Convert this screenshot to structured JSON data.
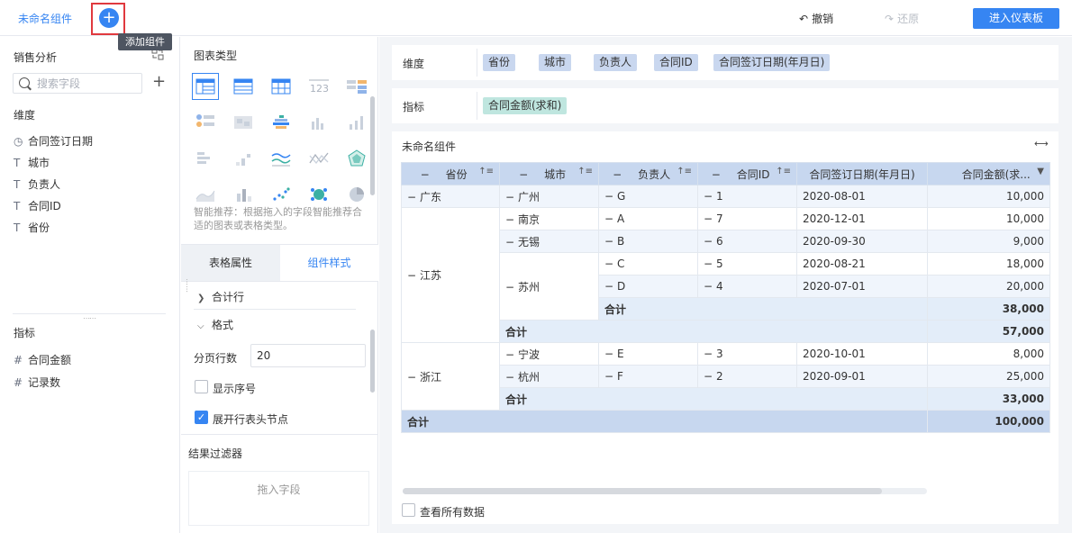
{
  "topbar": {
    "component_name": "未命名组件",
    "add_tooltip": "添加组件",
    "undo": "撤销",
    "redo": "还原",
    "enter_dashboard": "进入仪表板"
  },
  "left": {
    "dataset": "销售分析",
    "search_placeholder": "搜索字段",
    "dim_title": "维度",
    "dimensions": [
      {
        "icon": "clock-icon",
        "label": "合同签订日期"
      },
      {
        "icon": "text-type-icon",
        "label": "城市"
      },
      {
        "icon": "text-type-icon",
        "label": "负责人"
      },
      {
        "icon": "text-type-icon",
        "label": "合同ID"
      },
      {
        "icon": "text-type-icon",
        "label": "省份"
      }
    ],
    "ind_title": "指标",
    "indicators": [
      {
        "label": "合同金额"
      },
      {
        "label": "记录数"
      }
    ]
  },
  "mid": {
    "chart_type_title": "图表类型",
    "smart_tip": "智能推荐：根据拖入的字段智能推荐合适的图表或表格类型。",
    "tab_table": "表格属性",
    "tab_style": "组件样式",
    "sum_row": "合计行",
    "format": "格式",
    "page_rows_label": "分页行数",
    "page_rows_value": "20",
    "show_seq": "显示序号",
    "expand_nodes": "展开行表头节点",
    "filter_title": "结果过滤器",
    "drop_hint": "拖入字段"
  },
  "right": {
    "dim_label": "维度",
    "dim_fields": [
      "省份",
      "城市",
      "负责人",
      "合同ID",
      "合同签订日期(年月日)"
    ],
    "ind_label": "指标",
    "ind_fields": [
      "合同金额(求和)"
    ],
    "table_title": "未命名组件",
    "view_all": "查看所有数据",
    "headers": [
      "省份",
      "城市",
      "负责人",
      "合同ID",
      "合同签订日期(年月日)",
      "合同金额(求..."
    ],
    "rows": {
      "gd": "广东",
      "gz": "广州",
      "g": "G",
      "g_id": "1",
      "g_date": "2020-08-01",
      "g_amt": "10,000",
      "js": "江苏",
      "nj": "南京",
      "a": "A",
      "a_id": "7",
      "a_date": "2020-12-01",
      "a_amt": "10,000",
      "wx": "无锡",
      "b": "B",
      "b_id": "6",
      "b_date": "2020-09-30",
      "b_amt": "9,000",
      "sz": "苏州",
      "c": "C",
      "c_id": "5",
      "c_date": "2020-08-21",
      "c_amt": "18,000",
      "d": "D",
      "d_id": "4",
      "d_date": "2020-07-01",
      "d_amt": "20,000",
      "sz_total": "38,000",
      "js_total": "57,000",
      "zj": "浙江",
      "nb": "宁波",
      "e": "E",
      "e_id": "3",
      "e_date": "2020-10-01",
      "e_amt": "8,000",
      "hz": "杭州",
      "f": "F",
      "f_id": "2",
      "f_date": "2020-09-01",
      "f_amt": "25,000",
      "zj_total": "33,000",
      "grand_total": "100,000",
      "sum_label": "合计"
    }
  },
  "colors": {
    "accent": "#3685f2",
    "header": "#c7d7ef",
    "dim_pill": "#c9d7ef",
    "ind_pill": "#bfe6df"
  }
}
